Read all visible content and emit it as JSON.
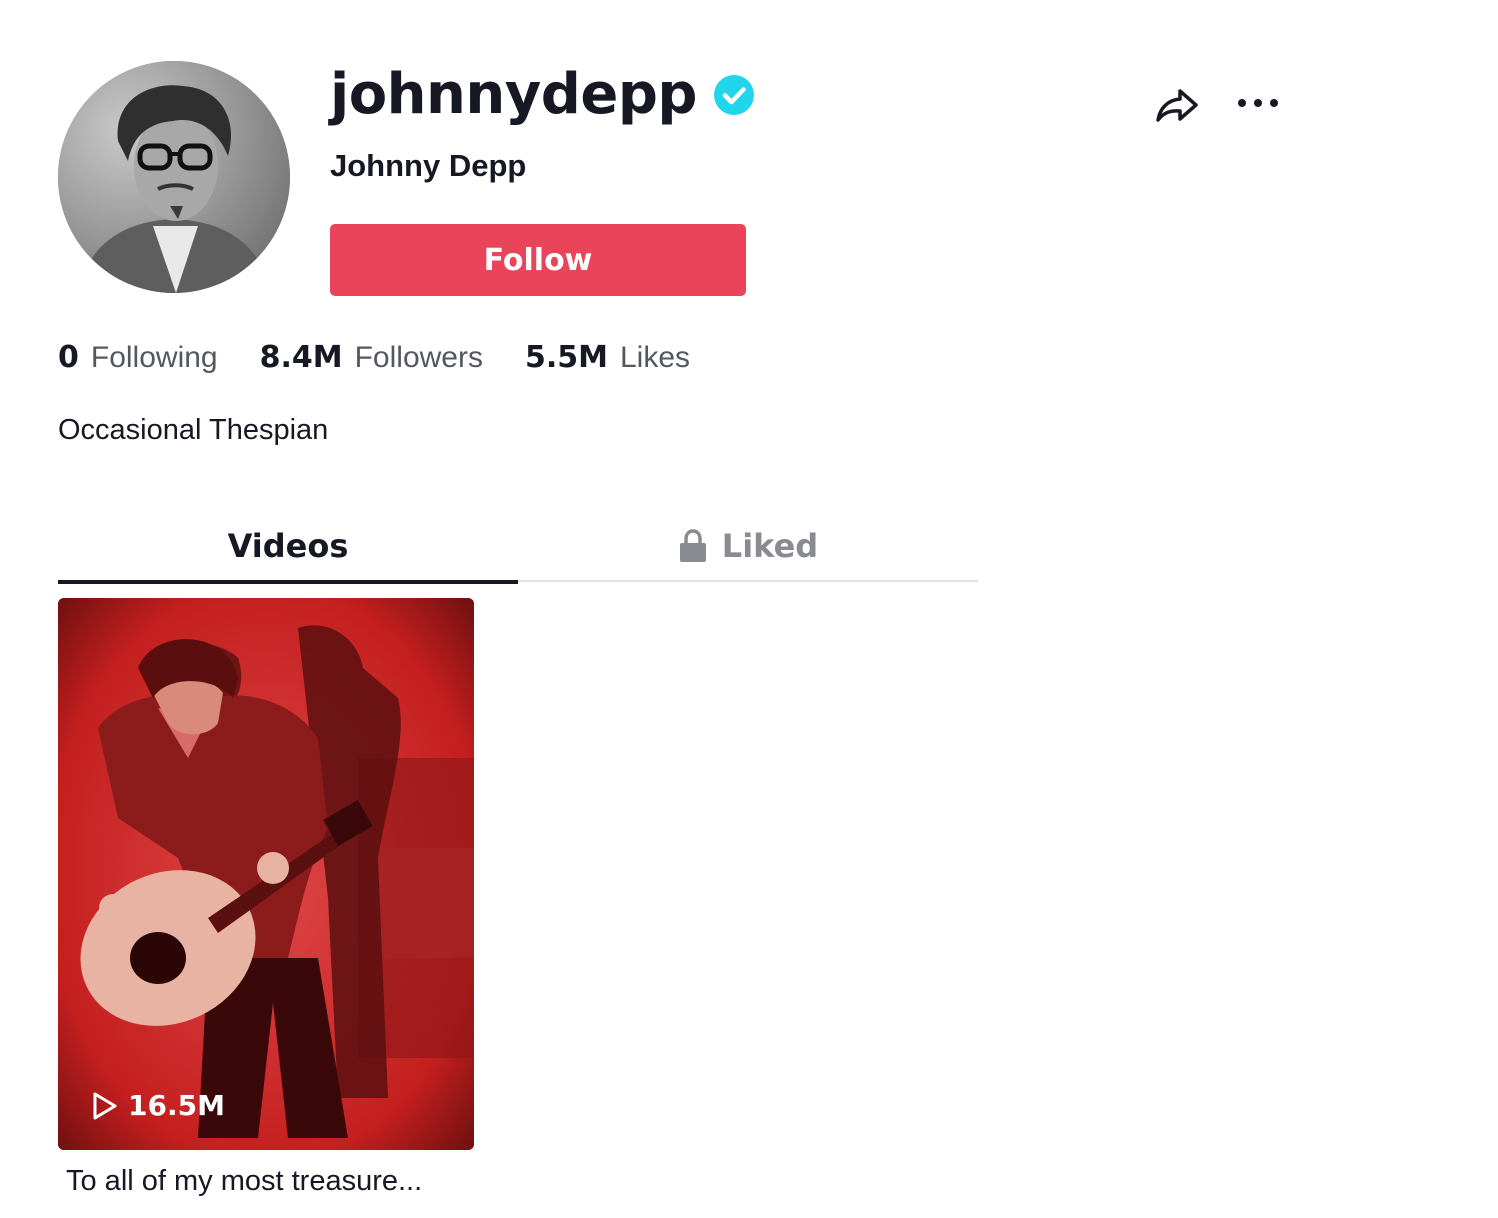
{
  "profile": {
    "username": "johnnydepp",
    "verified_icon": "verified-check-icon",
    "display_name": "Johnny Depp",
    "follow_label": "Follow",
    "bio": "Occasional Thespian",
    "avatar_icon": "profile-photo"
  },
  "actions": {
    "share_icon": "share-arrow-icon",
    "more_icon": "more-dots-icon"
  },
  "stats": [
    {
      "value": "0",
      "label": "Following"
    },
    {
      "value": "8.4M",
      "label": "Followers"
    },
    {
      "value": "5.5M",
      "label": "Likes"
    }
  ],
  "tabs": {
    "videos": "Videos",
    "liked": "Liked",
    "liked_icon": "lock-icon"
  },
  "videos": [
    {
      "views": "16.5M",
      "caption": "To all of my most treasure...",
      "play_icon": "play-icon"
    }
  ],
  "colors": {
    "follow_button": "#ea445a",
    "verified_badge": "#20d5ec",
    "text_primary": "#161823",
    "text_secondary": "#555761"
  }
}
